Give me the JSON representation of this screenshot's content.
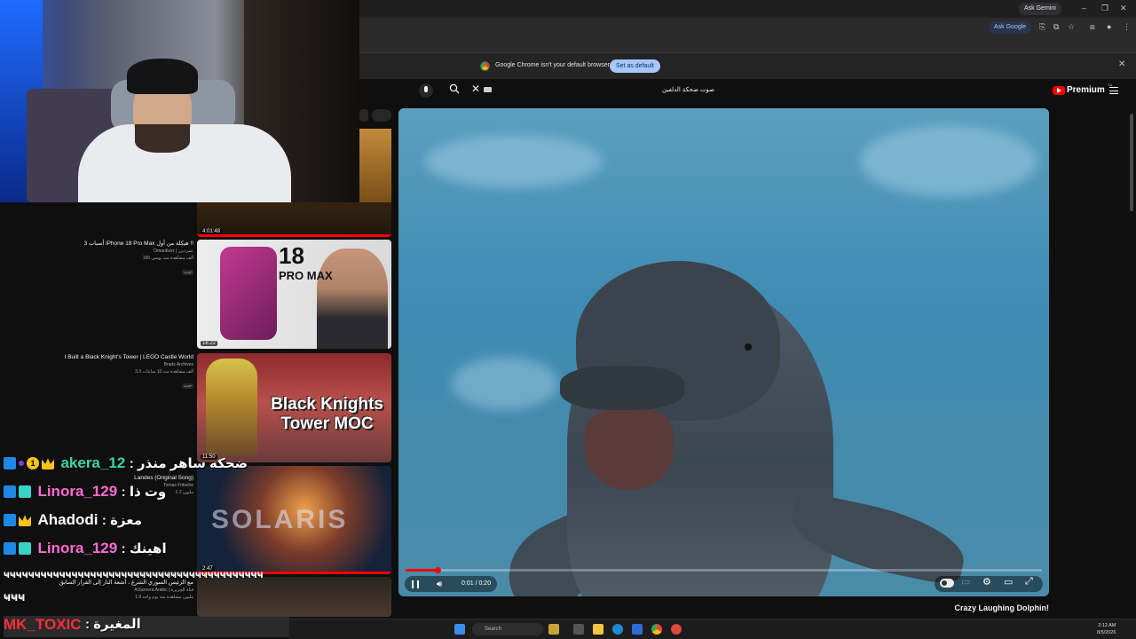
{
  "browser": {
    "ask_gemini": "Ask Gemini",
    "ask_google": "Ask Google",
    "infobar_message": "Google Chrome isn't your default browser",
    "set_default_label": "Set as default"
  },
  "youtube": {
    "search_query": "صوت ضحكة الدلفين",
    "premium_label": "Premium",
    "premium_region": "SA"
  },
  "player": {
    "time": "0:01 / 0:20",
    "progress_fraction": 0.05,
    "title": "Crazy Laughing Dolphin!"
  },
  "recommendations": {
    "chip_b": "",
    "items": [
      {
        "title": "",
        "channel": "",
        "meta": "",
        "duration": "4:01:48",
        "watched_fraction": 1.0
      },
      {
        "title": "3 أسباب iPhone 18 Pro Max هيكلة من أول !!",
        "channel": "Omardizer | عمرديزر",
        "meta": "190 ألف مشاهدة منذ يومين",
        "new_badge": "جديد",
        "duration": "16:22",
        "thumb_text_big": "18",
        "thumb_text_small": "PRO MAX"
      },
      {
        "title": "I Built a Black Knight's Tower | LEGO Castle World",
        "channel": "Brads Archives",
        "meta": "3.3 ألف مشاهدة منذ 10 ساعات",
        "new_badge": "جديد",
        "duration": "11:50",
        "thumb_text": "Black Knights Tower MOC"
      },
      {
        "title": "Landes (Original Song)",
        "channel": "Tomas Fritsche",
        "meta": "1.7 مليون",
        "duration": "2:47",
        "thumb_text": "SOLARIS"
      },
      {
        "title": "مع الرئيس السوري الشرع ، أشعة النار إلى القرار السابق",
        "channel": "AlJazeera Arabic | قناة الجزيرة",
        "meta": "1.9 مليون مشاهدة منذ يوم واحد",
        "duration": ""
      }
    ]
  },
  "chat": {
    "messages": [
      {
        "user": "akera_12",
        "color": "#3dd6a3",
        "text": ": ضحكه ساهر منذر",
        "badges": [
          "prime",
          "dot",
          "one",
          "crown"
        ]
      },
      {
        "user": "Linora_129",
        "color": "#ff6bd1",
        "text": ": وت ذا",
        "badges": [
          "prime",
          "gift"
        ]
      },
      {
        "user": "Ahadodi",
        "color": "#ffffff",
        "text": ": معزة",
        "badges": [
          "prime",
          "crown"
        ]
      },
      {
        "user": "Linora_129",
        "color": "#ff6bd1",
        "text": ": اهينك",
        "badges": [
          "prime",
          "gift"
        ]
      }
    ],
    "spam_line": "ҹҹҹҹҹҹҹҹҹҹҹҹҹҹҹҹҹҹҹҹҹҹҹҹҹҹҹҹҹҹҹҹҹҹҹҹҹҹҹҹҹҹ",
    "spam_line2": "ҹҹҹ",
    "last_user": "MK_TOXIC",
    "last_text": ": المغيرة"
  },
  "taskbar": {
    "search_placeholder": "Search",
    "clock_time": "2:12 AM",
    "clock_date": "8/5/2026"
  }
}
